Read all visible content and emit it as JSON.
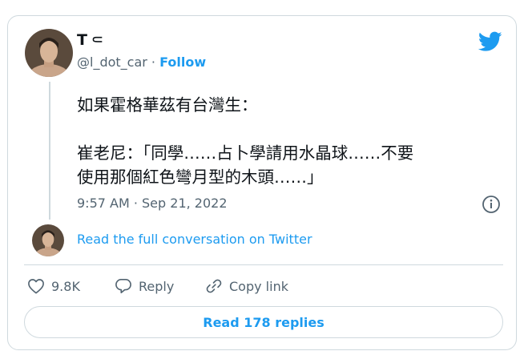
{
  "author": {
    "name": "T⸦",
    "handle": "@l_dot_car",
    "separator": " · ",
    "follow_label": "Follow"
  },
  "tweet": {
    "text": "如果霍格華茲有台灣生：\n\n崔老尼：「同學……占卜學請用水晶球……不要\n使用那個紅色彎月型的木頭……」",
    "timestamp": "9:57 AM · Sep 21, 2022"
  },
  "conversation": {
    "link_label": "Read the full conversation on Twitter"
  },
  "actions": {
    "likes_count": "9.8K",
    "reply_label": "Reply",
    "copy_link_label": "Copy link"
  },
  "replies": {
    "button_label": "Read 178 replies"
  },
  "colors": {
    "accent": "#1d9bf0",
    "text_primary": "#0f1419",
    "text_secondary": "#536471",
    "border": "#cfd9de"
  },
  "icons": [
    "twitter-bird-icon",
    "info-icon",
    "heart-icon",
    "reply-bubble-icon",
    "link-icon"
  ]
}
